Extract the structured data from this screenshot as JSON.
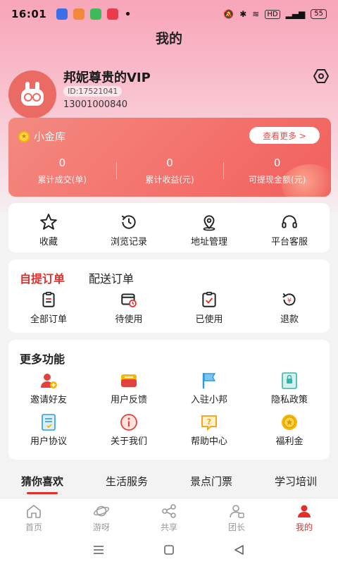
{
  "status_bar": {
    "time": "16:01",
    "net": "HD",
    "battery": "55"
  },
  "page": {
    "title": "我的"
  },
  "profile": {
    "name": "邦妮尊贵的VIP",
    "id": "ID:17521041",
    "phone": "13001000840"
  },
  "vault": {
    "title": "小金库",
    "more_label": "查看更多 >",
    "stats": [
      {
        "value": "0",
        "label": "累计成交(单)"
      },
      {
        "value": "0",
        "label": "累计收益(元)"
      },
      {
        "value": "0",
        "label": "可提现金额(元)"
      }
    ]
  },
  "quick_menu": [
    {
      "label": "收藏",
      "icon": "star-icon"
    },
    {
      "label": "浏览记录",
      "icon": "history-icon"
    },
    {
      "label": "地址管理",
      "icon": "location-icon"
    },
    {
      "label": "平台客服",
      "icon": "headset-icon"
    }
  ],
  "orders": {
    "tabs": [
      "自提订单",
      "配送订单"
    ],
    "items": [
      {
        "label": "全部订单",
        "icon": "clipboard-icon"
      },
      {
        "label": "待使用",
        "icon": "pending-icon"
      },
      {
        "label": "已使用",
        "icon": "checked-icon"
      },
      {
        "label": "退款",
        "icon": "refund-icon"
      }
    ]
  },
  "more": {
    "title": "更多功能",
    "items": [
      {
        "label": "邀请好友",
        "icon": "invite-icon",
        "color": "#e0423c"
      },
      {
        "label": "用户反馈",
        "icon": "feedback-icon",
        "color": "#f5b800"
      },
      {
        "label": "入驻小邦",
        "icon": "flag-icon",
        "color": "#2c9be0"
      },
      {
        "label": "隐私政策",
        "icon": "privacy-icon",
        "color": "#33b6a6"
      },
      {
        "label": "用户协议",
        "icon": "agreement-icon",
        "color": "#2c9be0"
      },
      {
        "label": "关于我们",
        "icon": "info-icon",
        "color": "#e0423c"
      },
      {
        "label": "帮助中心",
        "icon": "help-icon",
        "color": "#f5a000"
      },
      {
        "label": "福利金",
        "icon": "coin-icon",
        "color": "#f5b800"
      }
    ]
  },
  "categories": [
    "猜你喜欢",
    "生活服务",
    "景点门票",
    "学习培训"
  ],
  "nav": [
    {
      "label": "首页",
      "icon": "home-icon"
    },
    {
      "label": "游呀",
      "icon": "planet-icon"
    },
    {
      "label": "共享",
      "icon": "share-icon"
    },
    {
      "label": "团长",
      "icon": "leader-icon"
    },
    {
      "label": "我的",
      "icon": "user-icon"
    }
  ],
  "colors": {
    "accent": "#e0302c",
    "vault": "#f4706b"
  }
}
